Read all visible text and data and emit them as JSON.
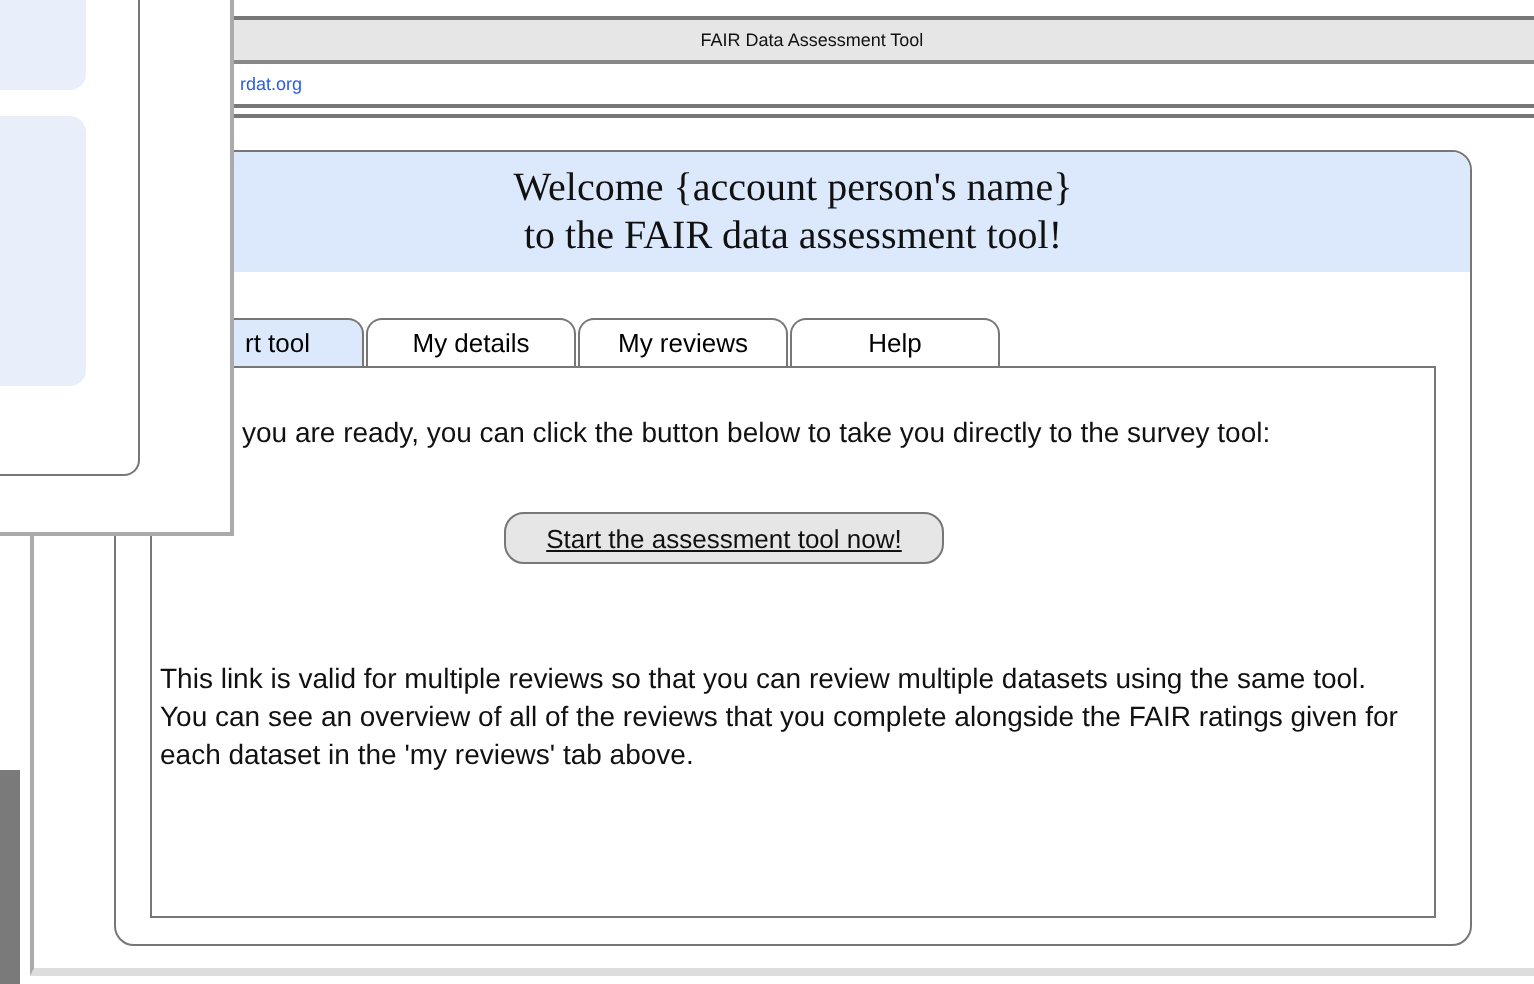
{
  "window": {
    "title": "FAIR Data Assessment Tool",
    "url": "rdat.org"
  },
  "welcome": {
    "lines": [
      "Welcome {account person's name}",
      "to the FAIR data assessment tool!"
    ]
  },
  "tabs": [
    {
      "label": "rt tool",
      "selected": true
    },
    {
      "label": "My details",
      "selected": false
    },
    {
      "label": "My reviews",
      "selected": false
    },
    {
      "label": "Help",
      "selected": false
    }
  ],
  "panel": {
    "intro": "you are ready, you can click the button below to take you directly to the survey tool:",
    "button": "Start the assessment tool now!",
    "note": "This link is valid for multiple reviews so that you can review multiple datasets using the same tool. You can see an overview of all of the reviews that you complete alongside the FAIR ratings given for each dataset in the 'my reviews' tab above."
  }
}
